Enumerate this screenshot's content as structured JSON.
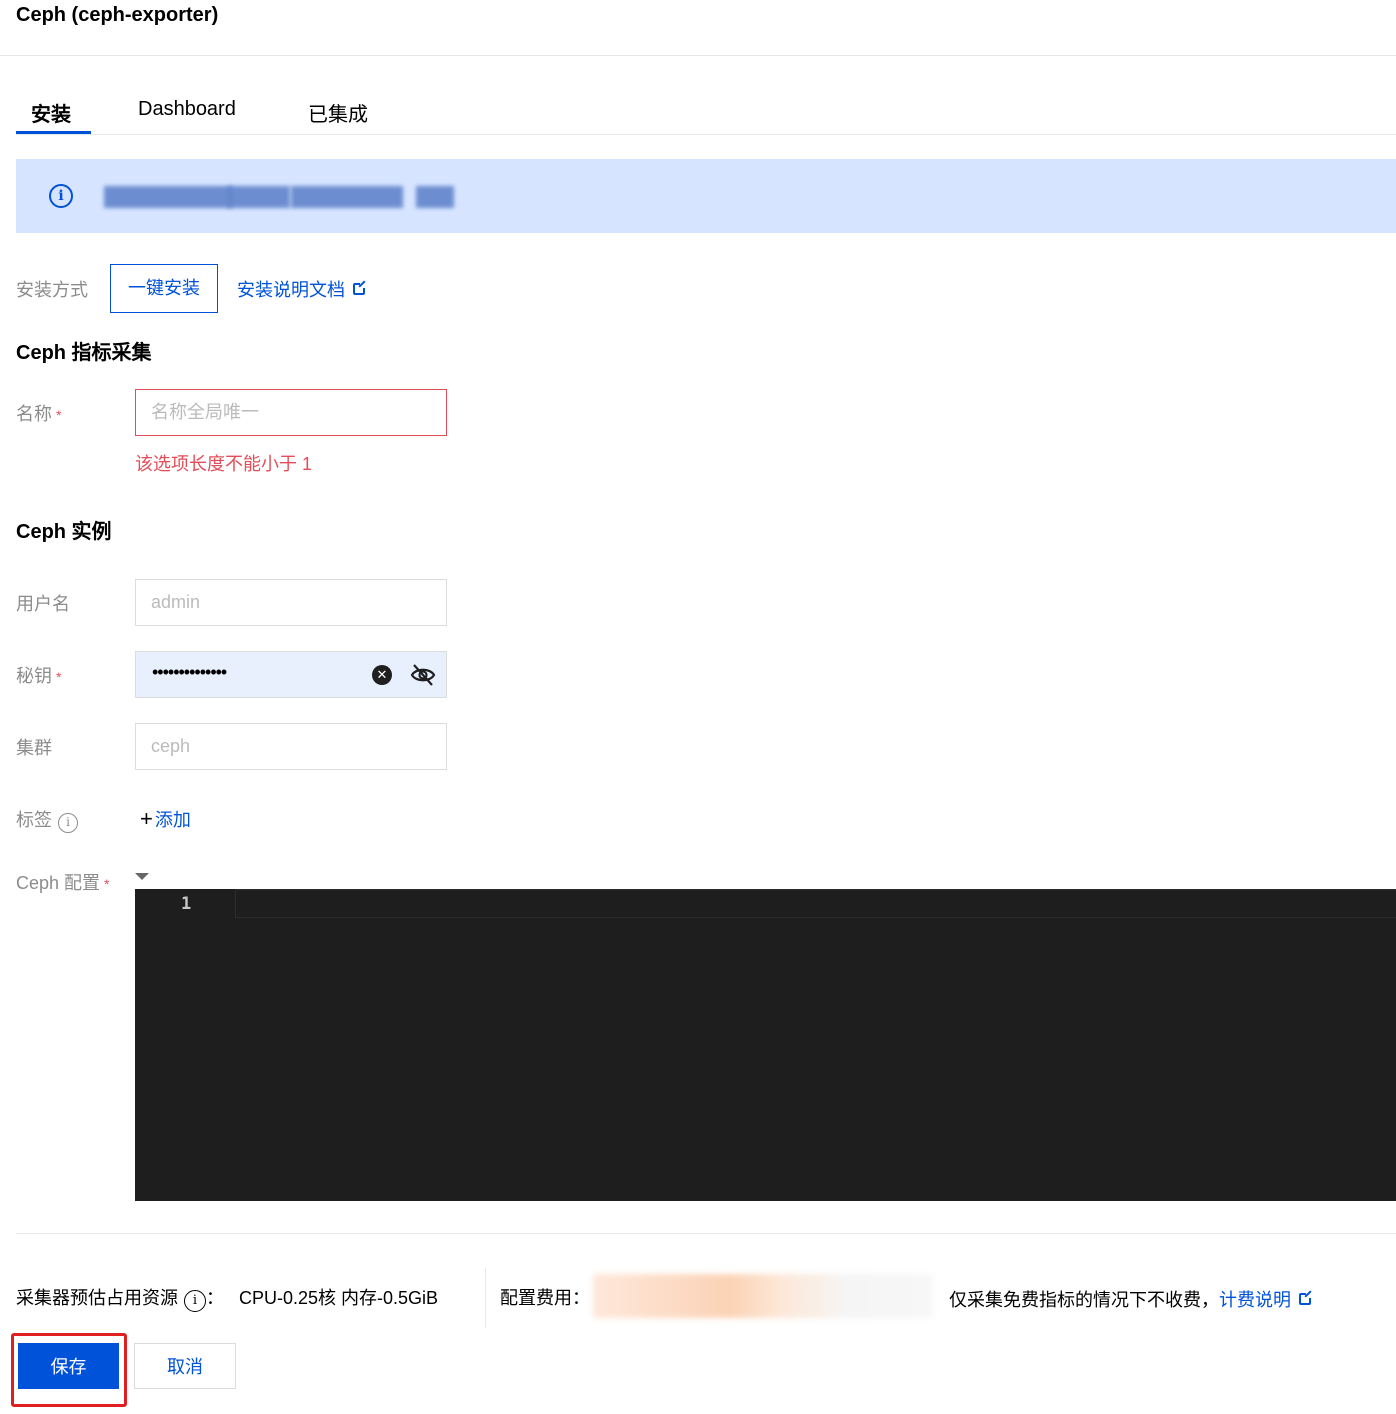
{
  "header": {
    "title": "Ceph (ceph-exporter)"
  },
  "tabs": [
    {
      "label": "安装",
      "active": true
    },
    {
      "label": "Dashboard",
      "active": false
    },
    {
      "label": "已集成",
      "active": false
    }
  ],
  "banner": {
    "icon": "info-icon"
  },
  "install": {
    "label": "安装方式",
    "button_label": "一键安装",
    "doc_link": "安装说明文档"
  },
  "metrics_section": {
    "title": "Ceph 指标采集",
    "name_label": "名称",
    "required_mark": "*",
    "name_placeholder": "名称全局唯一",
    "name_value": "",
    "name_error": "该选项长度不能小于 1"
  },
  "instance_section": {
    "title": "Ceph 实例",
    "username_label": "用户名",
    "username_placeholder": "admin",
    "secret_label": "秘钥",
    "secret_value_masked": "••••••••••••••",
    "cluster_label": "集群",
    "cluster_placeholder": "ceph",
    "tags_label": "标签",
    "add_label": "添加",
    "config_label": "Ceph 配置"
  },
  "editor": {
    "line_numbers": [
      "1"
    ],
    "content": ""
  },
  "footer": {
    "resource_label": "采集器预估占用资源",
    "resource_suffix": "：",
    "resource_value": "CPU-0.25核 内存-0.5GiB",
    "cost_label": "配置费用：",
    "cost_note": "仅采集免费指标的情况下不收费，",
    "billing_link": "计费说明"
  },
  "actions": {
    "save_label": "保存",
    "cancel_label": "取消"
  },
  "colors": {
    "primary": "#0052d9",
    "error": "#e34d59",
    "banner_bg": "#d6e4ff",
    "editor_bg": "#1e1e1e",
    "highlight": "#e02020"
  }
}
